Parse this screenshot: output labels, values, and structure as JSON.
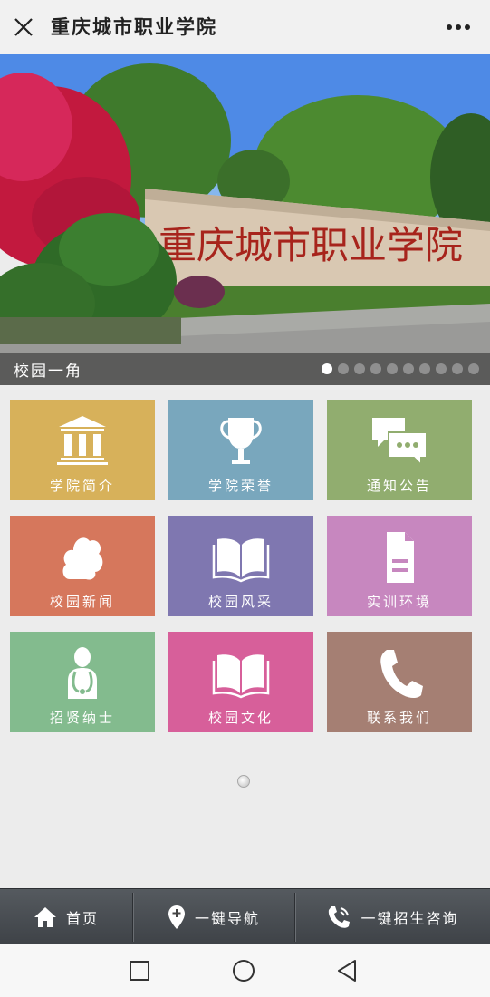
{
  "header": {
    "title": "重庆城市职业学院"
  },
  "banner": {
    "caption": "校园一角",
    "slide_count": 10,
    "active_slide": 1,
    "sign_text": "重庆城市职业学院"
  },
  "tiles": [
    {
      "label": "学院简介",
      "icon": "building-icon",
      "color": "#d7b15a"
    },
    {
      "label": "学院荣誉",
      "icon": "trophy-icon",
      "color": "#79a7bd"
    },
    {
      "label": "通知公告",
      "icon": "chat-bubbles-icon",
      "color": "#91ad6f"
    },
    {
      "label": "校园新闻",
      "icon": "cloud-icon",
      "color": "#d6775c"
    },
    {
      "label": "校园风采",
      "icon": "open-book-icon",
      "color": "#7f77b0"
    },
    {
      "label": "实训环境",
      "icon": "document-icon",
      "color": "#c787bf"
    },
    {
      "label": "招贤纳士",
      "icon": "doctor-icon",
      "color": "#83bb8e"
    },
    {
      "label": "校园文化",
      "icon": "open-book-icon",
      "color": "#d75f9a"
    },
    {
      "label": "联系我们",
      "icon": "phone-icon",
      "color": "#a57f73"
    }
  ],
  "bottom_nav": {
    "home": "首页",
    "navigate": "一键导航",
    "consult": "一键招生咨询"
  }
}
